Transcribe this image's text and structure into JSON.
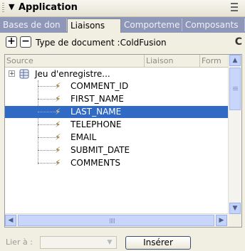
{
  "panel": {
    "title": "Application"
  },
  "tabs": [
    {
      "label": "Bases de don"
    },
    {
      "label": "Liaisons"
    },
    {
      "label": "Comporteme"
    },
    {
      "label": "Composants"
    }
  ],
  "toolbar": {
    "add_label": "+",
    "remove_label": "−",
    "doctype_text": "Type de document :ColdFusion",
    "refresh_label": "C"
  },
  "grid": {
    "columns": [
      "Source",
      "Liaison",
      "Form"
    ],
    "recordset": {
      "expander": "+",
      "label": "Jeu d'enregistre..."
    },
    "fields": [
      {
        "label": "COMMENT_ID",
        "selected": false
      },
      {
        "label": "FIRST_NAME",
        "selected": false
      },
      {
        "label": "LAST_NAME",
        "selected": true
      },
      {
        "label": "TELEPHONE",
        "selected": false
      },
      {
        "label": "EMAIL",
        "selected": false
      },
      {
        "label": "SUBMIT_DATE",
        "selected": false
      },
      {
        "label": "COMMENTS",
        "selected": false
      }
    ]
  },
  "bottom": {
    "bind_label": "Lier à :",
    "insert_label": "Insérer"
  },
  "colors": {
    "selection": "#316ac5",
    "tabbar": "#8f97b8"
  }
}
